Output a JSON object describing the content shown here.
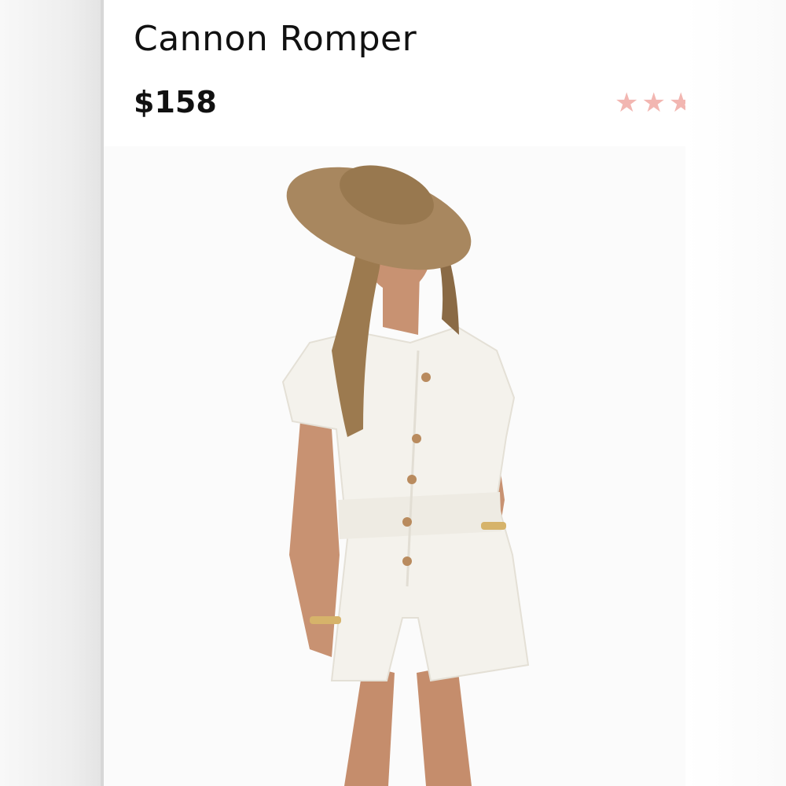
{
  "product": {
    "title": "Cannon Romper",
    "price": "$158"
  },
  "rating": {
    "stars_visible": 3,
    "star_glyph": "★",
    "color": "#f2b6b1"
  },
  "image": {
    "subject": "model-photo-icon"
  },
  "colors": {
    "background": "#ffffff",
    "text": "#111111",
    "hat": "#a8875f",
    "romper": "#f4f2ec",
    "skin": "#c89272",
    "hair": "#9c7a4f"
  }
}
